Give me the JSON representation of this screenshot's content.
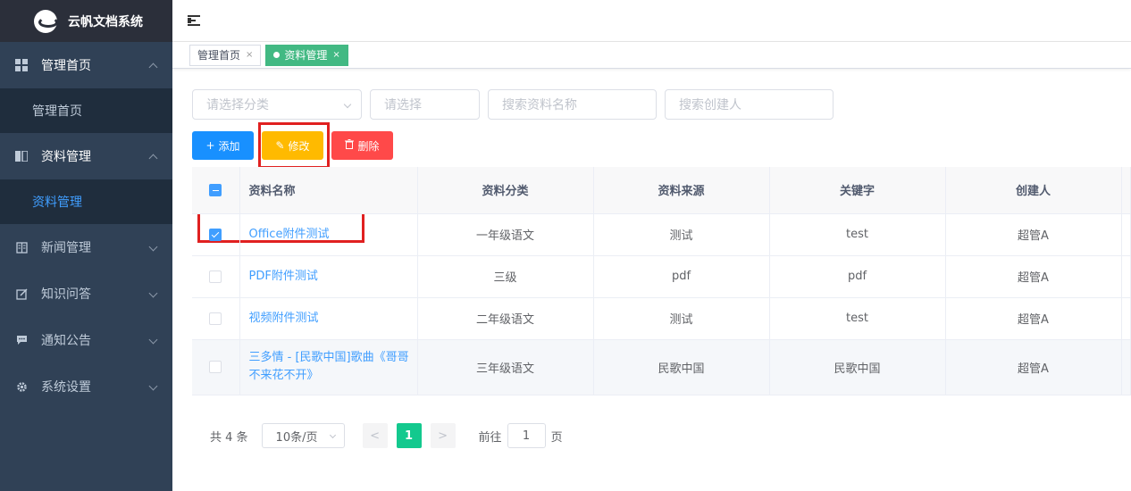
{
  "app": {
    "title": "云帆文档系统"
  },
  "sidebar": {
    "items": [
      {
        "label": "管理首页",
        "icon": "dashboard-grid-icon",
        "open": true,
        "children": [
          "管理首页"
        ]
      },
      {
        "label": "资料管理",
        "icon": "book-icon",
        "open": true,
        "children": [
          "资料管理"
        ]
      },
      {
        "label": "新闻管理",
        "icon": "newspaper-icon"
      },
      {
        "label": "知识问答",
        "icon": "edit-note-icon"
      },
      {
        "label": "通知公告",
        "icon": "message-icon"
      },
      {
        "label": "系统设置",
        "icon": "gear-icon"
      }
    ]
  },
  "tags": [
    {
      "label": "管理首页",
      "close": "×"
    },
    {
      "label": "资料管理",
      "close": "×"
    }
  ],
  "filters": {
    "category_placeholder": "请选择分类",
    "select_placeholder": "请选择",
    "name_placeholder": "搜索资料名称",
    "creator_placeholder": "搜索创建人"
  },
  "toolbar": {
    "add_icon": "+",
    "add_label": "添加",
    "edit_icon": "✎",
    "edit_label": "修改",
    "delete_icon": "🗑",
    "delete_label": "删除"
  },
  "table": {
    "columns": [
      "资料名称",
      "资料分类",
      "资料来源",
      "关键字",
      "创建人"
    ],
    "rows": [
      {
        "checked": true,
        "name": "Office附件测试",
        "category": "一年级语文",
        "source": "测试",
        "keyword": "test",
        "creator": "超管A"
      },
      {
        "checked": false,
        "name": "PDF附件测试",
        "category": "三级",
        "source": "pdf",
        "keyword": "pdf",
        "creator": "超管A"
      },
      {
        "checked": false,
        "name": "视频附件测试",
        "category": "二年级语文",
        "source": "测试",
        "keyword": "test",
        "creator": "超管A"
      },
      {
        "checked": false,
        "name": "三多情 - [民歌中国]歌曲《哥哥不来花不开》",
        "category": "三年级语文",
        "source": "民歌中国",
        "keyword": "民歌中国",
        "creator": "超管A"
      }
    ]
  },
  "pagination": {
    "total": "共 4 条",
    "page_size": "10条/页",
    "prev": "<",
    "current": "1",
    "next": ">",
    "goto_prefix": "前往",
    "goto_value": "1",
    "goto_suffix": "页"
  },
  "colors": {
    "sidebar_bg": "#304156",
    "accent": "#409eff",
    "tag_active": "#42b983",
    "btn_add": "#1890ff",
    "btn_edit": "#ffba00",
    "btn_delete": "#ff4949",
    "highlight": "#e02020"
  }
}
